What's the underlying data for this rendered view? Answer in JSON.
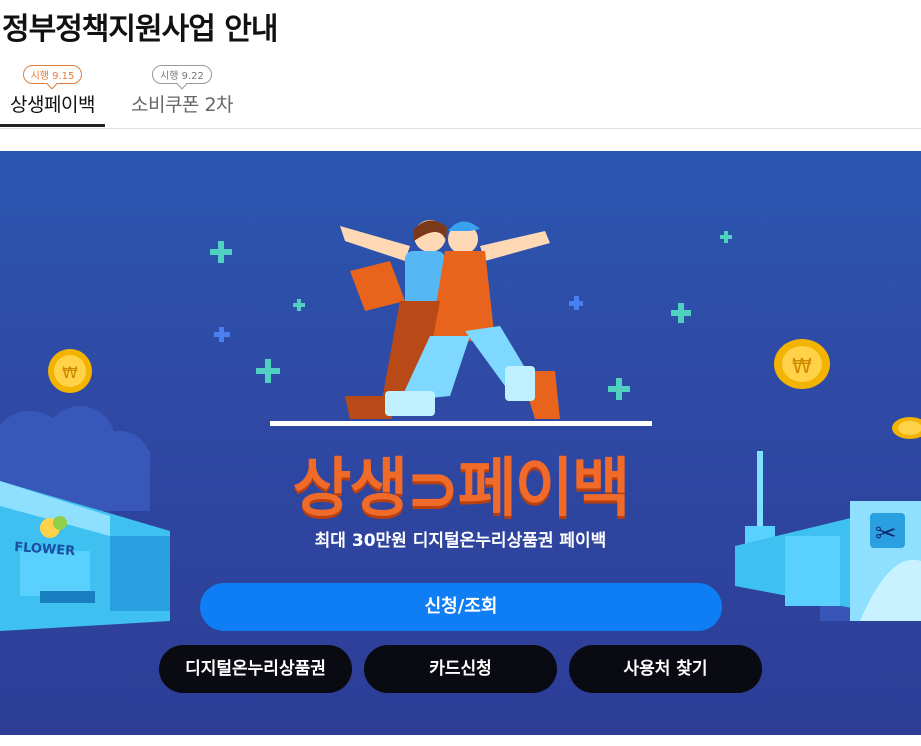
{
  "page": {
    "title": "정부정책지원사업 안내"
  },
  "tabs": [
    {
      "badge": "시행 9.15",
      "label": "상생페이백",
      "active": true
    },
    {
      "badge": "시행 9.22",
      "label": "소비쿠폰 2차",
      "active": false
    }
  ],
  "banner": {
    "headline": "상생⊃페이백",
    "subtitle": "최대 30만원 디지털온누리상품권 페이백",
    "store_sign": "FLOWER",
    "primary_button": "신청/조회",
    "secondary_buttons": [
      "디지털온누리상품권",
      "카드신청",
      "사용처 찾기"
    ]
  },
  "colors": {
    "accent_orange": "#f06a2a",
    "primary_blue": "#0f7df3",
    "banner_bg": "#2f4aa5",
    "button_dark": "#0a0a12"
  }
}
